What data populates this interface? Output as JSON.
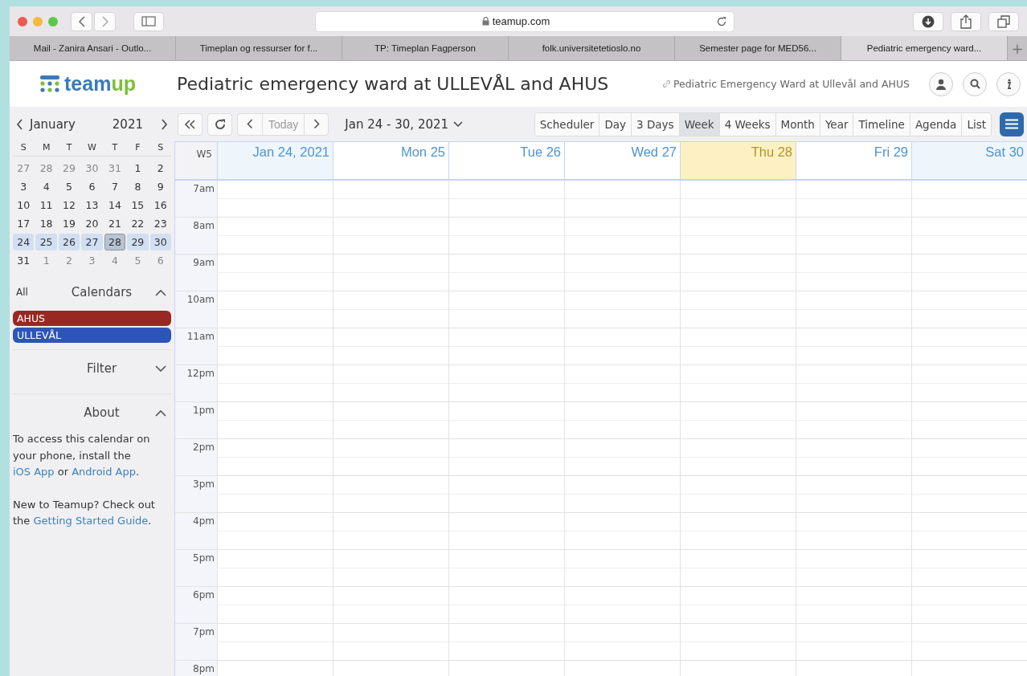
{
  "browser": {
    "address": "teamup.com",
    "tabs": [
      {
        "label": "Mail - Zanira Ansari - Outlo...",
        "selected": false
      },
      {
        "label": "Timeplan og ressurser for f...",
        "selected": false
      },
      {
        "label": "TP: Timeplan Fagperson",
        "selected": false
      },
      {
        "label": "folk.universitetetioslo.no",
        "selected": false
      },
      {
        "label": "Semester page for MED56...",
        "selected": false
      },
      {
        "label": "Pediatric emergency ward...",
        "selected": true
      }
    ],
    "new_tab": "+"
  },
  "header": {
    "logo_a": "team",
    "logo_b": "up",
    "title": "Pediatric emergency ward at ULLEVÅL and AHUS",
    "link": "Pediatric Emergency Ward at Ullevål and AHUS"
  },
  "mini_calendar": {
    "month": "January",
    "year": "2021",
    "weekdays": [
      "S",
      "M",
      "T",
      "W",
      "T",
      "F",
      "S"
    ],
    "weeks": [
      [
        {
          "label": "27",
          "muted": true,
          "selected": false,
          "today": false
        },
        {
          "label": "28",
          "muted": true,
          "selected": false,
          "today": false
        },
        {
          "label": "29",
          "muted": true,
          "selected": false,
          "today": false
        },
        {
          "label": "30",
          "muted": true,
          "selected": false,
          "today": false
        },
        {
          "label": "31",
          "muted": true,
          "selected": false,
          "today": false
        },
        {
          "label": "1",
          "muted": false,
          "selected": false,
          "today": false
        },
        {
          "label": "2",
          "muted": false,
          "selected": false,
          "today": false
        }
      ],
      [
        {
          "label": "3",
          "muted": false,
          "selected": false,
          "today": false
        },
        {
          "label": "4",
          "muted": false,
          "selected": false,
          "today": false
        },
        {
          "label": "5",
          "muted": false,
          "selected": false,
          "today": false
        },
        {
          "label": "6",
          "muted": false,
          "selected": false,
          "today": false
        },
        {
          "label": "7",
          "muted": false,
          "selected": false,
          "today": false
        },
        {
          "label": "8",
          "muted": false,
          "selected": false,
          "today": false
        },
        {
          "label": "9",
          "muted": false,
          "selected": false,
          "today": false
        }
      ],
      [
        {
          "label": "10",
          "muted": false,
          "selected": false,
          "today": false
        },
        {
          "label": "11",
          "muted": false,
          "selected": false,
          "today": false
        },
        {
          "label": "12",
          "muted": false,
          "selected": false,
          "today": false
        },
        {
          "label": "13",
          "muted": false,
          "selected": false,
          "today": false
        },
        {
          "label": "14",
          "muted": false,
          "selected": false,
          "today": false
        },
        {
          "label": "15",
          "muted": false,
          "selected": false,
          "today": false
        },
        {
          "label": "16",
          "muted": false,
          "selected": false,
          "today": false
        }
      ],
      [
        {
          "label": "17",
          "muted": false,
          "selected": false,
          "today": false
        },
        {
          "label": "18",
          "muted": false,
          "selected": false,
          "today": false
        },
        {
          "label": "19",
          "muted": false,
          "selected": false,
          "today": false
        },
        {
          "label": "20",
          "muted": false,
          "selected": false,
          "today": false
        },
        {
          "label": "21",
          "muted": false,
          "selected": false,
          "today": false
        },
        {
          "label": "22",
          "muted": false,
          "selected": false,
          "today": false
        },
        {
          "label": "23",
          "muted": false,
          "selected": false,
          "today": false
        }
      ],
      [
        {
          "label": "24",
          "muted": false,
          "selected": true,
          "today": false
        },
        {
          "label": "25",
          "muted": false,
          "selected": true,
          "today": false
        },
        {
          "label": "26",
          "muted": false,
          "selected": true,
          "today": false
        },
        {
          "label": "27",
          "muted": false,
          "selected": true,
          "today": false
        },
        {
          "label": "28",
          "muted": false,
          "selected": true,
          "today": true
        },
        {
          "label": "29",
          "muted": false,
          "selected": true,
          "today": false
        },
        {
          "label": "30",
          "muted": false,
          "selected": true,
          "today": false
        }
      ],
      [
        {
          "label": "31",
          "muted": false,
          "selected": false,
          "today": false
        },
        {
          "label": "1",
          "muted": true,
          "selected": false,
          "today": false
        },
        {
          "label": "2",
          "muted": true,
          "selected": false,
          "today": false
        },
        {
          "label": "3",
          "muted": true,
          "selected": false,
          "today": false
        },
        {
          "label": "4",
          "muted": true,
          "selected": false,
          "today": false
        },
        {
          "label": "5",
          "muted": true,
          "selected": false,
          "today": false
        },
        {
          "label": "6",
          "muted": true,
          "selected": false,
          "today": false
        }
      ]
    ]
  },
  "calendars": {
    "all": "All",
    "title": "Calendars",
    "expanded": true,
    "items": [
      {
        "name": "AHUS",
        "color": "#982822"
      },
      {
        "name": "ULLEVÅL",
        "color": "#2d54b8"
      }
    ]
  },
  "filter": {
    "title": "Filter",
    "expanded": false
  },
  "about": {
    "title": "About",
    "expanded": true,
    "paragraphs": [
      [
        {
          "kind": "text",
          "text": "To access this calendar on your phone, install the "
        },
        {
          "kind": "link",
          "text": "iOS App"
        },
        {
          "kind": "text",
          "text": " or "
        },
        {
          "kind": "link",
          "text": "Android App"
        },
        {
          "kind": "text",
          "text": "."
        }
      ],
      [
        {
          "kind": "text",
          "text": "New to Teamup? Check out the "
        },
        {
          "kind": "link",
          "text": "Getting Started Guide"
        },
        {
          "kind": "text",
          "text": "."
        }
      ]
    ]
  },
  "toolbar": {
    "today": "Today",
    "range": "Jan 24 - 30, 2021",
    "views": [
      {
        "label": "Scheduler",
        "selected": false
      },
      {
        "label": "Day",
        "selected": false
      },
      {
        "label": "3 Days",
        "selected": false
      },
      {
        "label": "Week",
        "selected": true
      },
      {
        "label": "4 Weeks",
        "selected": false
      },
      {
        "label": "Month",
        "selected": false
      },
      {
        "label": "Year",
        "selected": false
      },
      {
        "label": "Timeline",
        "selected": false
      },
      {
        "label": "Agenda",
        "selected": false
      },
      {
        "label": "List",
        "selected": false
      }
    ]
  },
  "week": {
    "number": "W5",
    "days": [
      {
        "label": "Jan 24, 2021",
        "today": false,
        "weekend": true
      },
      {
        "label": "Mon 25",
        "today": false,
        "weekend": false
      },
      {
        "label": "Tue 26",
        "today": false,
        "weekend": false
      },
      {
        "label": "Wed 27",
        "today": false,
        "weekend": false
      },
      {
        "label": "Thu 28",
        "today": true,
        "weekend": false
      },
      {
        "label": "Fri 29",
        "today": false,
        "weekend": false
      },
      {
        "label": "Sat 30",
        "today": false,
        "weekend": true
      }
    ],
    "hours": [
      "7am",
      "8am",
      "9am",
      "10am",
      "11am",
      "12pm",
      "1pm",
      "2pm",
      "3pm",
      "4pm",
      "5pm",
      "6pm",
      "7pm",
      "8pm"
    ]
  }
}
